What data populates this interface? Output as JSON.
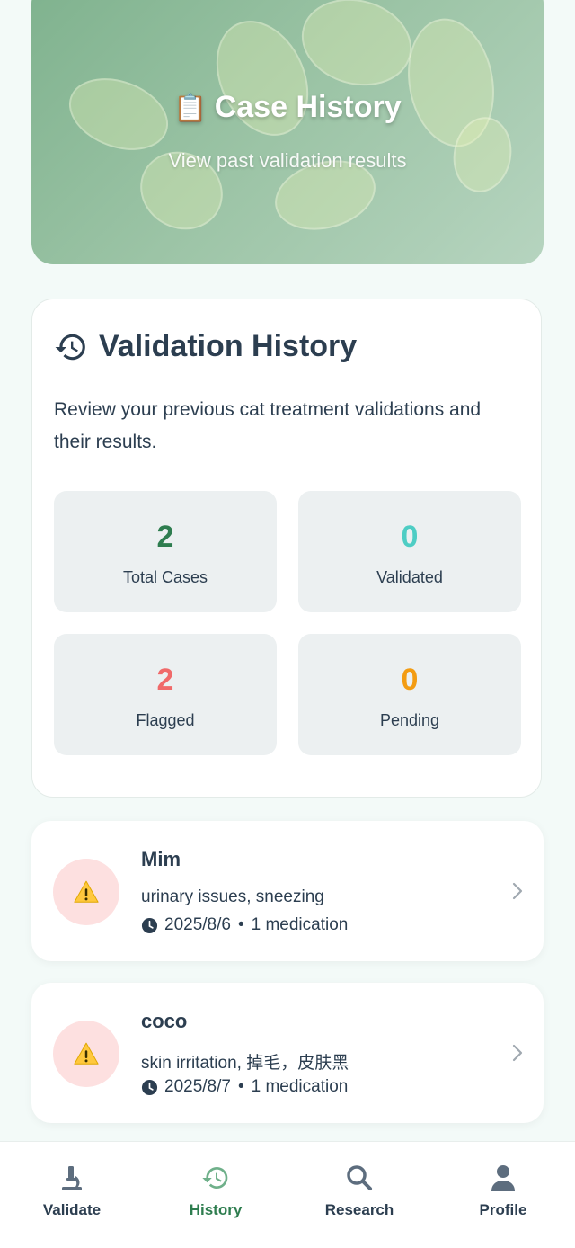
{
  "hero": {
    "icon": "clipboard-icon",
    "icon_glyph": "📋",
    "title": "Case History",
    "subtitle": "View past validation results"
  },
  "history_card": {
    "icon": "history-icon",
    "title": "Validation History",
    "description": "Review your previous cat treatment validations and their results.",
    "stats": [
      {
        "value": "2",
        "label": "Total Cases",
        "color": "#2e7d4f"
      },
      {
        "value": "0",
        "label": "Validated",
        "color": "#4ecdc4"
      },
      {
        "value": "2",
        "label": "Flagged",
        "color": "#f06a6a"
      },
      {
        "value": "0",
        "label": "Pending",
        "color": "#f39c12"
      }
    ]
  },
  "cases": [
    {
      "name": "Mim",
      "symptoms": "urinary issues, sneezing",
      "date": "2025/8/6",
      "separator": "•",
      "medications": "1 medication",
      "status_icon": "warning-icon"
    },
    {
      "name": "coco",
      "symptoms": "skin irritation, 掉毛，皮肤黑",
      "date": "2025/8/7",
      "separator": "•",
      "medications": "1 medication",
      "status_icon": "warning-icon"
    }
  ],
  "nav": {
    "items": [
      {
        "label": "Validate",
        "icon": "microscope-icon",
        "active": false
      },
      {
        "label": "History",
        "icon": "history-icon",
        "active": true
      },
      {
        "label": "Research",
        "icon": "search-icon",
        "active": false
      },
      {
        "label": "Profile",
        "icon": "user-icon",
        "active": false
      }
    ],
    "active_color": "#2e7d4f",
    "inactive_color": "#5d6d7e"
  }
}
